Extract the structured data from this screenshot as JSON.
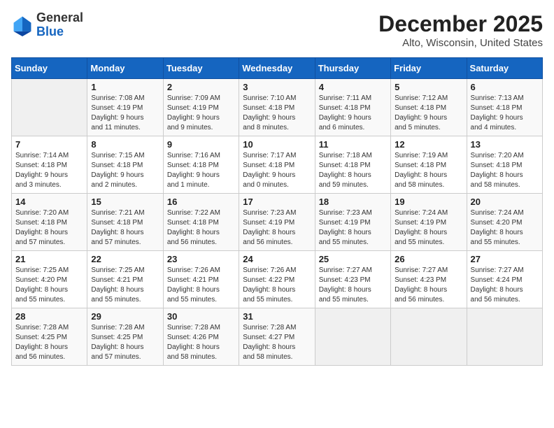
{
  "header": {
    "logo_line1": "General",
    "logo_line2": "Blue",
    "title": "December 2025",
    "subtitle": "Alto, Wisconsin, United States"
  },
  "weekdays": [
    "Sunday",
    "Monday",
    "Tuesday",
    "Wednesday",
    "Thursday",
    "Friday",
    "Saturday"
  ],
  "weeks": [
    [
      {
        "day": "",
        "info": ""
      },
      {
        "day": "1",
        "info": "Sunrise: 7:08 AM\nSunset: 4:19 PM\nDaylight: 9 hours\nand 11 minutes."
      },
      {
        "day": "2",
        "info": "Sunrise: 7:09 AM\nSunset: 4:19 PM\nDaylight: 9 hours\nand 9 minutes."
      },
      {
        "day": "3",
        "info": "Sunrise: 7:10 AM\nSunset: 4:18 PM\nDaylight: 9 hours\nand 8 minutes."
      },
      {
        "day": "4",
        "info": "Sunrise: 7:11 AM\nSunset: 4:18 PM\nDaylight: 9 hours\nand 6 minutes."
      },
      {
        "day": "5",
        "info": "Sunrise: 7:12 AM\nSunset: 4:18 PM\nDaylight: 9 hours\nand 5 minutes."
      },
      {
        "day": "6",
        "info": "Sunrise: 7:13 AM\nSunset: 4:18 PM\nDaylight: 9 hours\nand 4 minutes."
      }
    ],
    [
      {
        "day": "7",
        "info": "Sunrise: 7:14 AM\nSunset: 4:18 PM\nDaylight: 9 hours\nand 3 minutes."
      },
      {
        "day": "8",
        "info": "Sunrise: 7:15 AM\nSunset: 4:18 PM\nDaylight: 9 hours\nand 2 minutes."
      },
      {
        "day": "9",
        "info": "Sunrise: 7:16 AM\nSunset: 4:18 PM\nDaylight: 9 hours\nand 1 minute."
      },
      {
        "day": "10",
        "info": "Sunrise: 7:17 AM\nSunset: 4:18 PM\nDaylight: 9 hours\nand 0 minutes."
      },
      {
        "day": "11",
        "info": "Sunrise: 7:18 AM\nSunset: 4:18 PM\nDaylight: 8 hours\nand 59 minutes."
      },
      {
        "day": "12",
        "info": "Sunrise: 7:19 AM\nSunset: 4:18 PM\nDaylight: 8 hours\nand 58 minutes."
      },
      {
        "day": "13",
        "info": "Sunrise: 7:20 AM\nSunset: 4:18 PM\nDaylight: 8 hours\nand 58 minutes."
      }
    ],
    [
      {
        "day": "14",
        "info": "Sunrise: 7:20 AM\nSunset: 4:18 PM\nDaylight: 8 hours\nand 57 minutes."
      },
      {
        "day": "15",
        "info": "Sunrise: 7:21 AM\nSunset: 4:18 PM\nDaylight: 8 hours\nand 57 minutes."
      },
      {
        "day": "16",
        "info": "Sunrise: 7:22 AM\nSunset: 4:18 PM\nDaylight: 8 hours\nand 56 minutes."
      },
      {
        "day": "17",
        "info": "Sunrise: 7:23 AM\nSunset: 4:19 PM\nDaylight: 8 hours\nand 56 minutes."
      },
      {
        "day": "18",
        "info": "Sunrise: 7:23 AM\nSunset: 4:19 PM\nDaylight: 8 hours\nand 55 minutes."
      },
      {
        "day": "19",
        "info": "Sunrise: 7:24 AM\nSunset: 4:19 PM\nDaylight: 8 hours\nand 55 minutes."
      },
      {
        "day": "20",
        "info": "Sunrise: 7:24 AM\nSunset: 4:20 PM\nDaylight: 8 hours\nand 55 minutes."
      }
    ],
    [
      {
        "day": "21",
        "info": "Sunrise: 7:25 AM\nSunset: 4:20 PM\nDaylight: 8 hours\nand 55 minutes."
      },
      {
        "day": "22",
        "info": "Sunrise: 7:25 AM\nSunset: 4:21 PM\nDaylight: 8 hours\nand 55 minutes."
      },
      {
        "day": "23",
        "info": "Sunrise: 7:26 AM\nSunset: 4:21 PM\nDaylight: 8 hours\nand 55 minutes."
      },
      {
        "day": "24",
        "info": "Sunrise: 7:26 AM\nSunset: 4:22 PM\nDaylight: 8 hours\nand 55 minutes."
      },
      {
        "day": "25",
        "info": "Sunrise: 7:27 AM\nSunset: 4:23 PM\nDaylight: 8 hours\nand 55 minutes."
      },
      {
        "day": "26",
        "info": "Sunrise: 7:27 AM\nSunset: 4:23 PM\nDaylight: 8 hours\nand 56 minutes."
      },
      {
        "day": "27",
        "info": "Sunrise: 7:27 AM\nSunset: 4:24 PM\nDaylight: 8 hours\nand 56 minutes."
      }
    ],
    [
      {
        "day": "28",
        "info": "Sunrise: 7:28 AM\nSunset: 4:25 PM\nDaylight: 8 hours\nand 56 minutes."
      },
      {
        "day": "29",
        "info": "Sunrise: 7:28 AM\nSunset: 4:25 PM\nDaylight: 8 hours\nand 57 minutes."
      },
      {
        "day": "30",
        "info": "Sunrise: 7:28 AM\nSunset: 4:26 PM\nDaylight: 8 hours\nand 58 minutes."
      },
      {
        "day": "31",
        "info": "Sunrise: 7:28 AM\nSunset: 4:27 PM\nDaylight: 8 hours\nand 58 minutes."
      },
      {
        "day": "",
        "info": ""
      },
      {
        "day": "",
        "info": ""
      },
      {
        "day": "",
        "info": ""
      }
    ]
  ]
}
